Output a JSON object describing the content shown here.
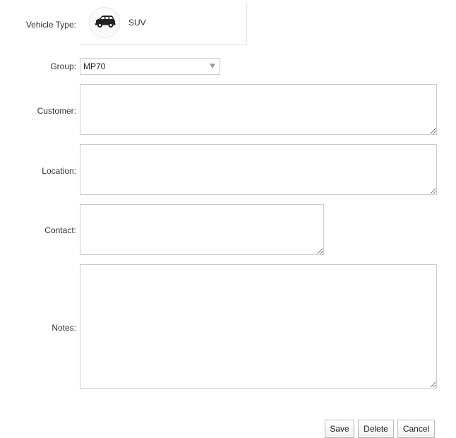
{
  "form": {
    "vehicle_type_label": "Vehicle Type:",
    "vehicle_type_value": "SUV",
    "vehicle_icon": "car-icon",
    "group_label": "Group:",
    "group_value": "MP70",
    "customer_label": "Customer:",
    "customer_value": "",
    "location_label": "Location:",
    "location_value": "",
    "contact_label": "Contact:",
    "contact_value": "",
    "notes_label": "Notes:",
    "notes_value": ""
  },
  "buttons": {
    "save_label": "Save",
    "delete_label": "Delete",
    "cancel_label": "Cancel"
  },
  "colors": {
    "border": "#cccccc",
    "text": "#333333",
    "background": "#ffffff"
  }
}
